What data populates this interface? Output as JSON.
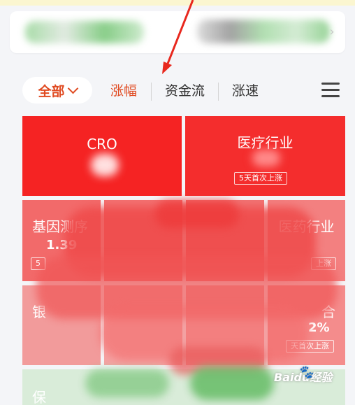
{
  "tabs": {
    "filter_label": "全部",
    "items": [
      {
        "label": "涨幅",
        "active": true
      },
      {
        "label": "资金流",
        "active": false
      },
      {
        "label": "涨速",
        "active": false
      }
    ],
    "menu_icon": "hamburger-menu-icon"
  },
  "tiles": [
    {
      "name": "CRO",
      "value": "",
      "badge": ""
    },
    {
      "name": "医疗行业",
      "value": "",
      "badge": "5天首次上涨"
    },
    {
      "name": "基因测序",
      "value": "1.39",
      "badge": "5"
    },
    {
      "name": "医药行业",
      "value": "",
      "badge": "上涨"
    },
    {
      "name": "银",
      "value": "",
      "badge": ""
    },
    {
      "name": "合",
      "value": "2%",
      "badge": "天首次上涨"
    },
    {
      "name": "保",
      "value": "",
      "badge": ""
    }
  ],
  "watermark": {
    "text": "Baidu经验"
  },
  "colors": {
    "accent": "#e04b22",
    "tile_strong_red": "#f52a2a",
    "tile_mid_red": "#f06060",
    "tile_light_red": "#f39494",
    "tile_green": "#cfe6cf"
  }
}
